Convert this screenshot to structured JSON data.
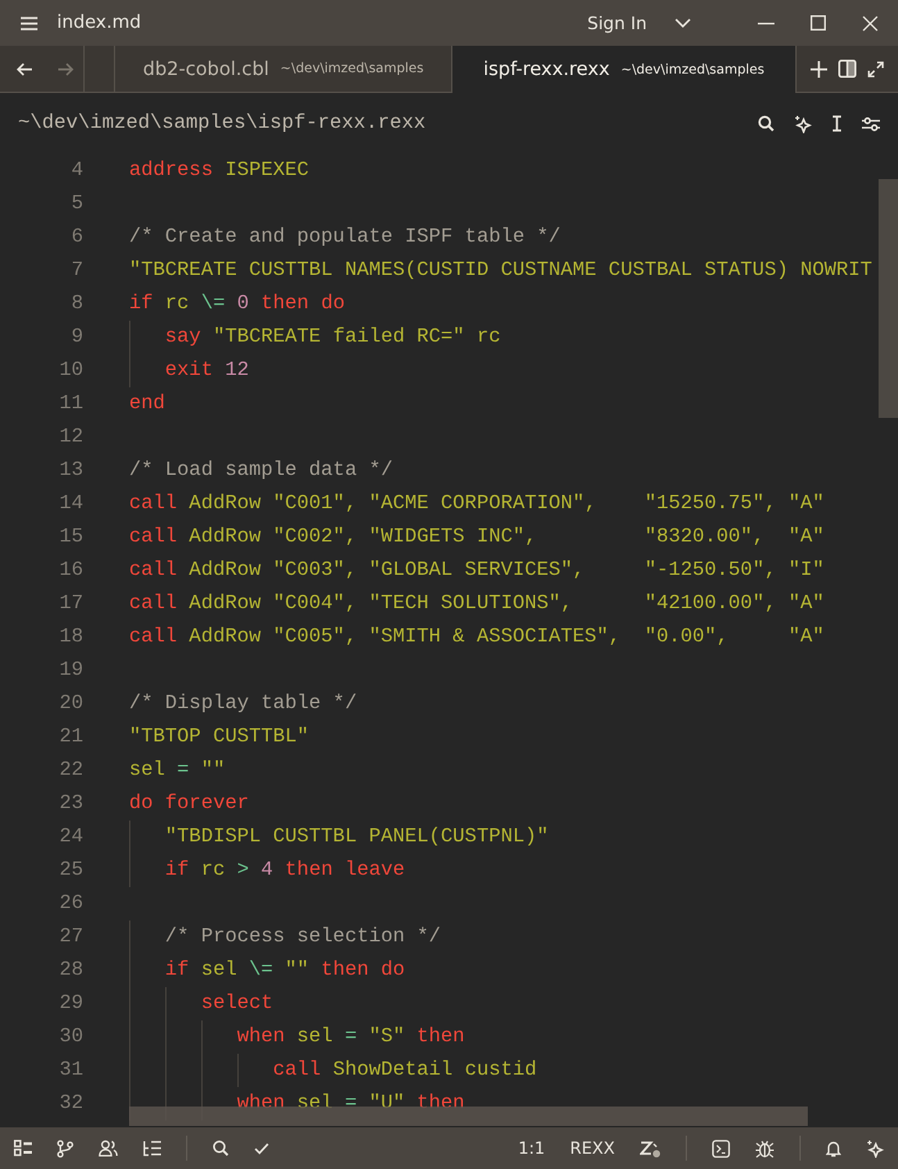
{
  "window": {
    "title": "index.md",
    "sign_in": "Sign In"
  },
  "nav": {
    "back_disabled": false,
    "forward_disabled": true
  },
  "tabs": [
    {
      "name": "db2-cobol.cbl",
      "path": "~\\dev\\imzed\\samples",
      "selected": false
    },
    {
      "name": "ispf-rexx.rexx",
      "path": "~\\dev\\imzed\\samples",
      "selected": true
    }
  ],
  "breadcrumb": "~\\dev\\imzed\\samples\\ispf-rexx.rexx",
  "code_lines": [
    {
      "number": "4",
      "tokens": [
        {
          "kind": "kw",
          "text": "address"
        },
        {
          "kind": "id",
          "text": " ISPEXEC"
        }
      ]
    },
    {
      "number": "5"
    },
    {
      "number": "6",
      "tokens": [
        {
          "kind": "cmt",
          "text": "/* Create and populate ISPF table */"
        }
      ]
    },
    {
      "number": "7",
      "tokens": [
        {
          "kind": "str",
          "text": "\"TBCREATE CUSTTBL NAMES(CUSTID CUSTNAME CUSTBAL STATUS) NOWRIT"
        }
      ]
    },
    {
      "number": "8",
      "tokens": [
        {
          "kind": "kw",
          "text": "if"
        },
        {
          "kind": "id",
          "text": " rc "
        },
        {
          "kind": "op",
          "text": "\\="
        },
        {
          "kind": "num",
          "text": " 0"
        },
        {
          "kind": "kw",
          "text": " then do"
        }
      ]
    },
    {
      "number": "9",
      "tokens": [
        {
          "kind": "kw",
          "text": "   say"
        },
        {
          "kind": "str",
          "text": " \"TBCREATE failed RC=\" rc"
        }
      ]
    },
    {
      "number": "10",
      "tokens": [
        {
          "kind": "kw",
          "text": "   exit"
        },
        {
          "kind": "num",
          "text": " 12"
        }
      ]
    },
    {
      "number": "11",
      "tokens": [
        {
          "kind": "kw",
          "text": "end"
        }
      ]
    },
    {
      "number": "12"
    },
    {
      "number": "13",
      "tokens": [
        {
          "kind": "cmt",
          "text": "/* Load sample data */"
        }
      ]
    },
    {
      "number": "14",
      "tokens": [
        {
          "kind": "kw",
          "text": "call"
        },
        {
          "kind": "id",
          "text": " AddRow \"C001\", \"ACME CORPORATION\",    \"15250.75\", \"A\""
        }
      ]
    },
    {
      "number": "15",
      "tokens": [
        {
          "kind": "kw",
          "text": "call"
        },
        {
          "kind": "id",
          "text": " AddRow \"C002\", \"WIDGETS INC\",         \"8320.00\",  \"A\""
        }
      ]
    },
    {
      "number": "16",
      "tokens": [
        {
          "kind": "kw",
          "text": "call"
        },
        {
          "kind": "id",
          "text": " AddRow \"C003\", \"GLOBAL SERVICES\",     \"-1250.50\", \"I\""
        }
      ]
    },
    {
      "number": "17",
      "tokens": [
        {
          "kind": "kw",
          "text": "call"
        },
        {
          "kind": "id",
          "text": " AddRow \"C004\", \"TECH SOLUTIONS\",      \"42100.00\", \"A\""
        }
      ]
    },
    {
      "number": "18",
      "tokens": [
        {
          "kind": "kw",
          "text": "call"
        },
        {
          "kind": "id",
          "text": " AddRow \"C005\", \"SMITH & ASSOCIATES\",  \"0.00\",     \"A\""
        }
      ]
    },
    {
      "number": "19"
    },
    {
      "number": "20",
      "tokens": [
        {
          "kind": "cmt",
          "text": "/* Display table */"
        }
      ]
    },
    {
      "number": "21",
      "tokens": [
        {
          "kind": "str",
          "text": "\"TBTOP CUSTTBL\""
        }
      ]
    },
    {
      "number": "22",
      "tokens": [
        {
          "kind": "id",
          "text": "sel "
        },
        {
          "kind": "op",
          "text": "="
        },
        {
          "kind": "str",
          "text": " \"\""
        }
      ]
    },
    {
      "number": "23",
      "tokens": [
        {
          "kind": "kw",
          "text": "do forever"
        }
      ]
    },
    {
      "number": "24",
      "tokens": [
        {
          "kind": "str",
          "text": "   \"TBDISPL CUSTTBL PANEL(CUSTPNL)\""
        }
      ]
    },
    {
      "number": "25",
      "tokens": [
        {
          "kind": "kw",
          "text": "   if"
        },
        {
          "kind": "id",
          "text": " rc "
        },
        {
          "kind": "op",
          "text": ">"
        },
        {
          "kind": "num",
          "text": " 4"
        },
        {
          "kind": "kw",
          "text": " then leave"
        }
      ]
    },
    {
      "number": "26"
    },
    {
      "number": "27",
      "tokens": [
        {
          "kind": "cmt",
          "text": "   /* Process selection */"
        }
      ]
    },
    {
      "number": "28",
      "tokens": [
        {
          "kind": "kw",
          "text": "   if"
        },
        {
          "kind": "id",
          "text": " sel "
        },
        {
          "kind": "op",
          "text": "\\="
        },
        {
          "kind": "str",
          "text": " \"\""
        },
        {
          "kind": "kw",
          "text": " then do"
        }
      ]
    },
    {
      "number": "29",
      "tokens": [
        {
          "kind": "kw",
          "text": "      select"
        }
      ]
    },
    {
      "number": "30",
      "tokens": [
        {
          "kind": "kw",
          "text": "         when"
        },
        {
          "kind": "id",
          "text": " sel "
        },
        {
          "kind": "op",
          "text": "="
        },
        {
          "kind": "str",
          "text": " \"S\""
        },
        {
          "kind": "kw",
          "text": " then"
        }
      ]
    },
    {
      "number": "31",
      "tokens": [
        {
          "kind": "kw",
          "text": "            call"
        },
        {
          "kind": "id",
          "text": " ShowDetail custid"
        }
      ]
    },
    {
      "number": "32",
      "tokens": [
        {
          "kind": "kw",
          "text": "         when"
        },
        {
          "kind": "id",
          "text": " sel "
        },
        {
          "kind": "op",
          "text": "="
        },
        {
          "kind": "str",
          "text": " \"U\""
        },
        {
          "kind": "kw",
          "text": " then"
        }
      ]
    }
  ],
  "status_bar": {
    "cursor": "1:1",
    "language": "REXX"
  }
}
